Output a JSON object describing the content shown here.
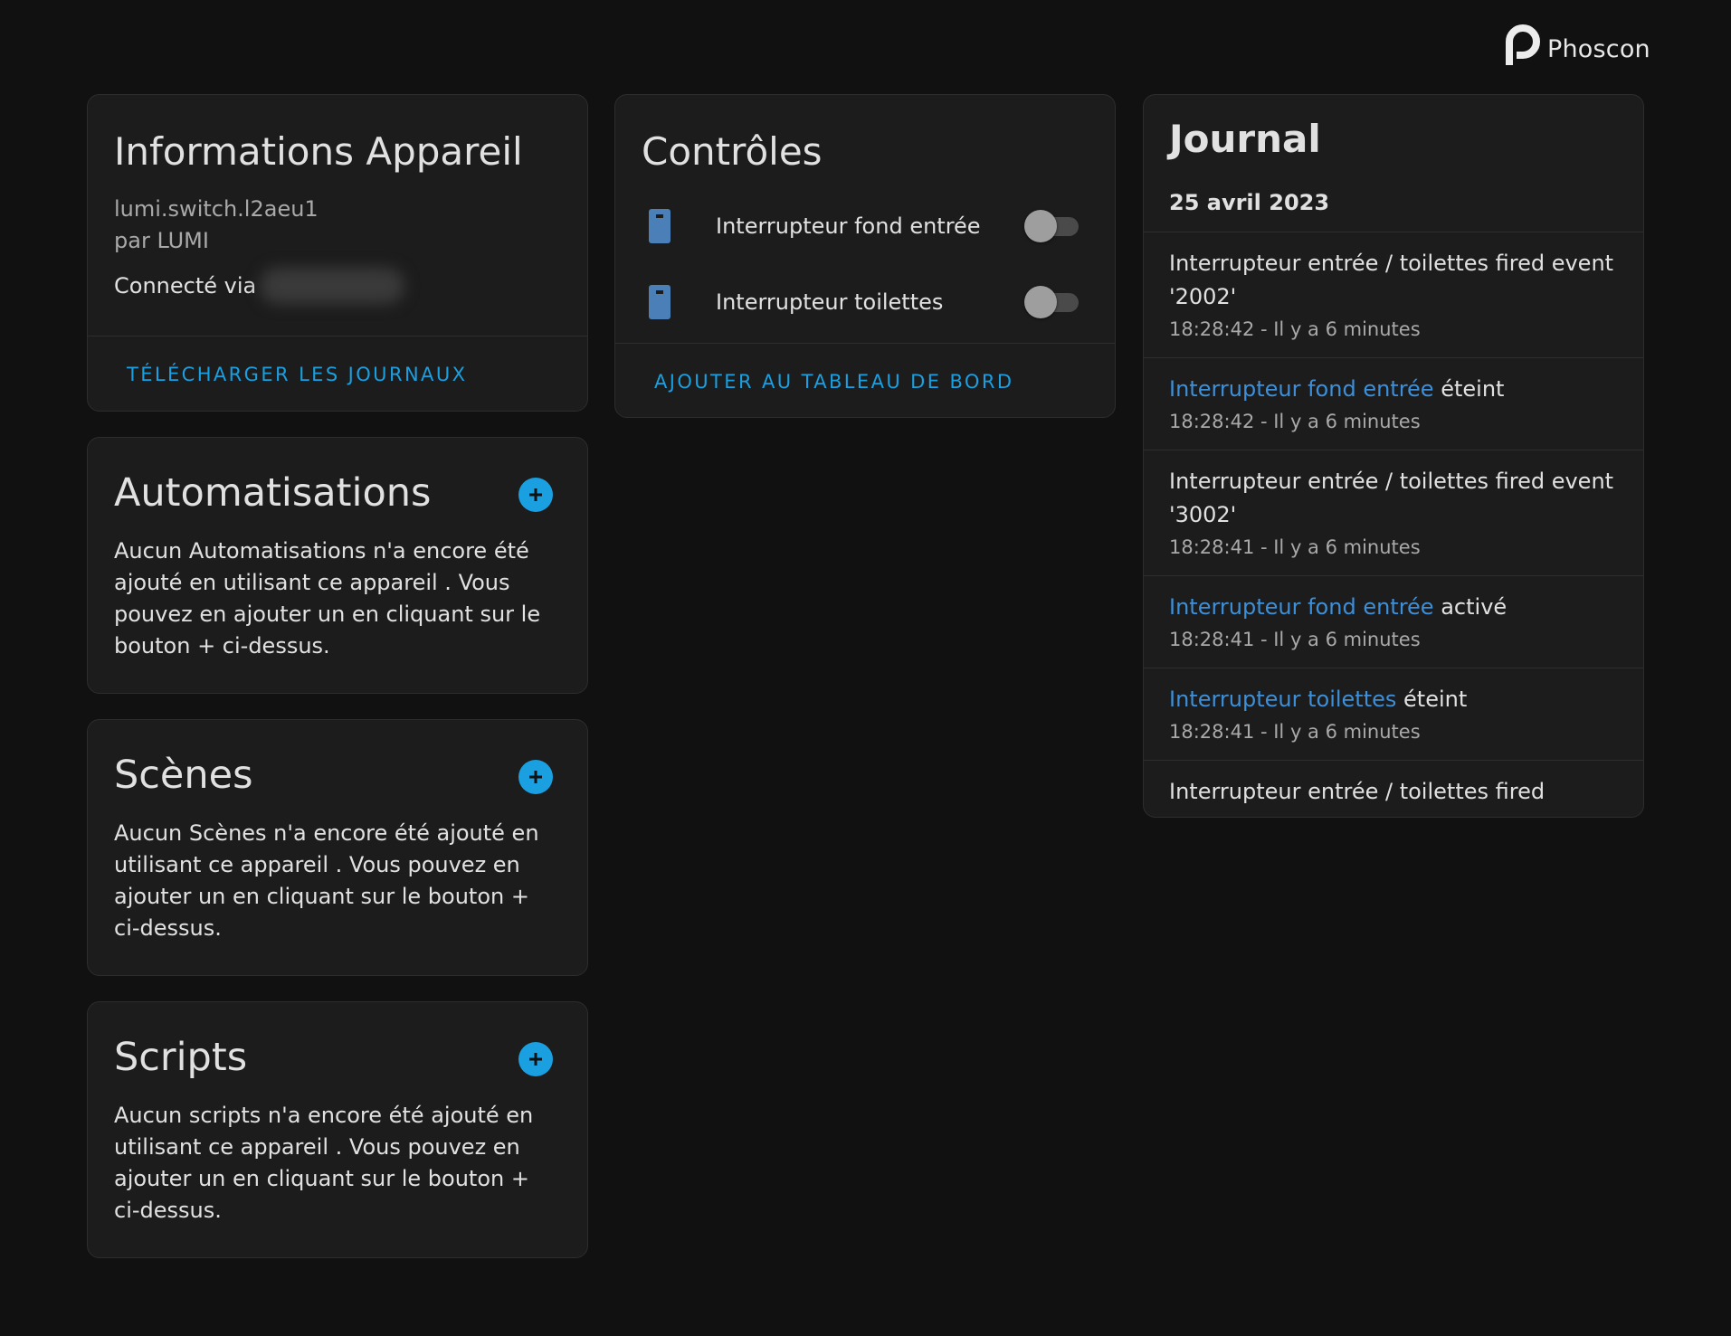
{
  "brand": {
    "name": "Phoscon"
  },
  "device_info": {
    "title": "Informations Appareil",
    "model": "lumi.switch.l2aeu1",
    "manufacturer": "par LUMI",
    "connected_label": "Connecté via",
    "action_label": "TÉLÉCHARGER LES JOURNAUX"
  },
  "automations": {
    "title": "Automatisations",
    "text": "Aucun Automatisations n'a encore été ajouté en utilisant ce appareil . Vous pouvez en ajouter un en cliquant sur le bouton + ci-dessus."
  },
  "scenes": {
    "title": "Scènes",
    "text": "Aucun Scènes n'a encore été ajouté en utilisant ce appareil . Vous pouvez en ajouter un en cliquant sur le bouton + ci-dessus."
  },
  "scripts": {
    "title": "Scripts",
    "text": "Aucun scripts n'a encore été ajouté en utilisant ce appareil . Vous pouvez en ajouter un en cliquant sur le bouton + ci-dessus."
  },
  "controls": {
    "title": "Contrôles",
    "items": [
      {
        "label": "Interrupteur fond entrée",
        "state": "off"
      },
      {
        "label": "Interrupteur toilettes",
        "state": "off"
      }
    ],
    "action_label": "AJOUTER AU TABLEAU DE BORD"
  },
  "journal": {
    "title": "Journal",
    "date": "25 avril 2023",
    "entries": [
      {
        "entity": "",
        "text": "Interrupteur entrée / toilettes fired event '2002'",
        "time": "18:28:42 - Il y a 6 minutes"
      },
      {
        "entity": "Interrupteur fond entrée",
        "text": " éteint",
        "time": "18:28:42 - Il y a 6 minutes"
      },
      {
        "entity": "",
        "text": "Interrupteur entrée / toilettes fired event '3002'",
        "time": "18:28:41 - Il y a 6 minutes"
      },
      {
        "entity": "Interrupteur fond entrée",
        "text": " activé",
        "time": "18:28:41 - Il y a 6 minutes"
      },
      {
        "entity": "Interrupteur toilettes",
        "text": " éteint",
        "time": "18:28:41 - Il y a 6 minutes"
      },
      {
        "entity": "",
        "text": "Interrupteur entrée / toilettes fired",
        "time": ""
      }
    ]
  },
  "colors": {
    "background": "#111111",
    "card": "#1c1c1c",
    "accent": "#1a9fe0",
    "entity_link": "#3c8fd8",
    "device_icon": "#4a7fb8"
  }
}
